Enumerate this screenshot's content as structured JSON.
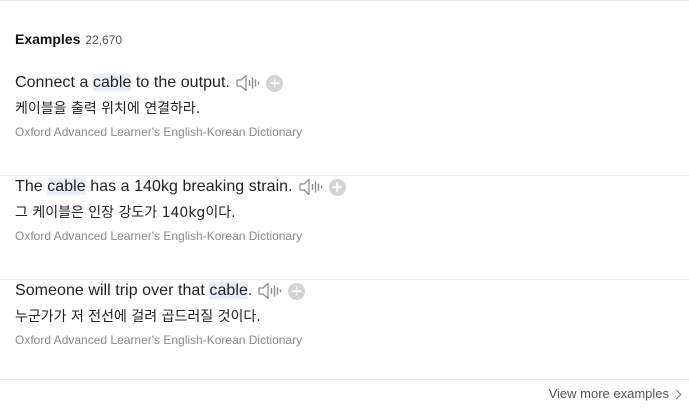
{
  "header": {
    "title": "Examples",
    "count": "22,670"
  },
  "examples": [
    {
      "before": "Connect a ",
      "keyword": "cable",
      "after": " to the output.",
      "translation": "케이블을 출력 위치에 연결하라.",
      "source": "Oxford Advanced Learner's English-Korean Dictionary"
    },
    {
      "before": "The ",
      "keyword": "cable",
      "after": " has a 140kg breaking strain.",
      "translation": "그 케이블은 인장 강도가 140kg이다.",
      "source": "Oxford Advanced Learner's English-Korean Dictionary"
    },
    {
      "before": "Someone will trip over that ",
      "keyword": "cable",
      "after": ".",
      "translation": "누군가가 저 전선에 걸려 곱드러질 것이다.",
      "source": "Oxford Advanced Learner's English-Korean Dictionary"
    }
  ],
  "footer": {
    "more_label": "View more examples"
  },
  "icons": {
    "speaker": "speaker-icon",
    "add": "plus-icon",
    "more": "chevron-right-icon"
  },
  "colors": {
    "highlight": "#e8f1fb",
    "add_button": "#d4d4d4"
  }
}
